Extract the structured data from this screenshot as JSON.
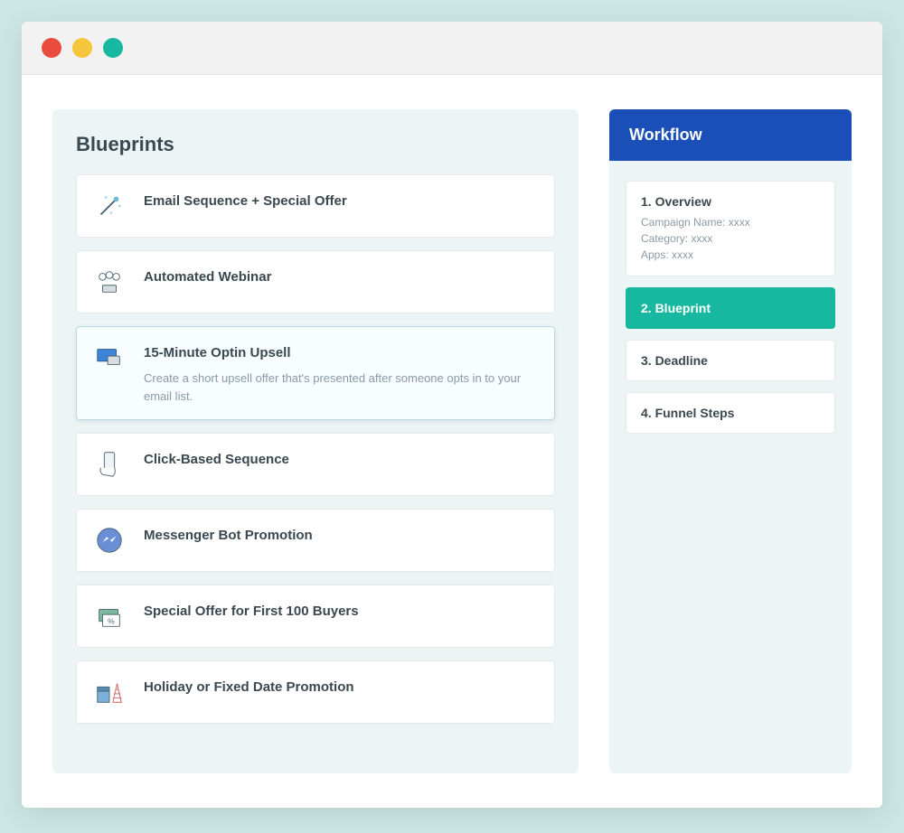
{
  "blueprints": {
    "title": "Blueprints",
    "items": [
      {
        "label": "Email Sequence + Special Offer",
        "icon": "wand-icon",
        "selected": false,
        "description": ""
      },
      {
        "label": "Automated Webinar",
        "icon": "people-icon",
        "selected": false,
        "description": ""
      },
      {
        "label": "15-Minute Optin Upsell",
        "icon": "screens-icon",
        "selected": true,
        "description": "Create a short upsell offer that's presented after someone opts in to your email list."
      },
      {
        "label": "Click-Based Sequence",
        "icon": "phone-hand-icon",
        "selected": false,
        "description": ""
      },
      {
        "label": "Messenger Bot Promotion",
        "icon": "messenger-icon",
        "selected": false,
        "description": ""
      },
      {
        "label": "Special Offer for First 100 Buyers",
        "icon": "coupon-icon",
        "selected": false,
        "description": ""
      },
      {
        "label": "Holiday or Fixed Date Promotion",
        "icon": "party-icon",
        "selected": false,
        "description": ""
      }
    ]
  },
  "workflow": {
    "title": "Workflow",
    "steps": [
      {
        "label": "1. Overview",
        "active": false,
        "sublines": [
          "Campaign Name: xxxx",
          "Category: xxxx",
          "Apps: xxxx"
        ]
      },
      {
        "label": "2. Blueprint",
        "active": true,
        "sublines": []
      },
      {
        "label": "3. Deadline",
        "active": false,
        "sublines": []
      },
      {
        "label": "4. Funnel Steps",
        "active": false,
        "sublines": []
      }
    ]
  }
}
